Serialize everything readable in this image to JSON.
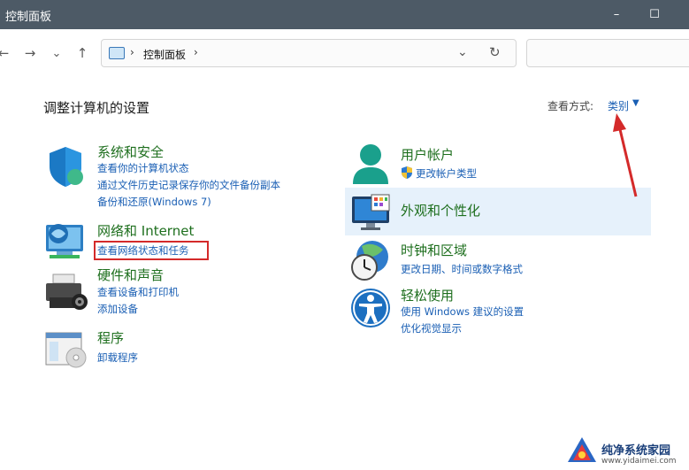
{
  "window": {
    "title": "控制面板",
    "minimize": "–",
    "maximize": "☐"
  },
  "nav": {
    "back": "←",
    "forward": "→",
    "recent": "⌄",
    "up": "↑"
  },
  "address": {
    "crumb": "控制面板",
    "sep1": "›",
    "sep2": "›",
    "dropdown": "⌄",
    "refresh": "↻",
    "icon": "control-panel-icon"
  },
  "search": {
    "placeholder": ""
  },
  "main": {
    "title": "调整计算机的设置",
    "view_label": "查看方式:",
    "view_value": "类别",
    "view_caret": "▼"
  },
  "left": [
    {
      "title": "系统和安全",
      "icon": "shield-icon",
      "links": [
        "查看你的计算机状态",
        "通过文件历史记录保存你的文件备份副本",
        "备份和还原(Windows 7)"
      ]
    },
    {
      "title": "网络和 Internet",
      "icon": "network-icon",
      "links": [
        "查看网络状态和任务"
      ]
    },
    {
      "title": "硬件和声音",
      "icon": "printer-icon",
      "links": [
        "查看设备和打印机",
        "添加设备"
      ]
    },
    {
      "title": "程序",
      "icon": "programs-icon",
      "links": [
        "卸载程序"
      ]
    }
  ],
  "right": [
    {
      "title": "用户帐户",
      "icon": "user-icon",
      "links": [
        "更改帐户类型"
      ]
    },
    {
      "title": "外观和个性化",
      "icon": "monitor-icon",
      "links": []
    },
    {
      "title": "时钟和区域",
      "icon": "clock-icon",
      "links": [
        "更改日期、时间或数字格式"
      ]
    },
    {
      "title": "轻松使用",
      "icon": "accessibility-icon",
      "links": [
        "使用 Windows 建议的设置",
        "优化视觉显示"
      ]
    }
  ],
  "annotations": {
    "highlight_color": "#d42a2a"
  },
  "watermark": {
    "name": "纯净系统家园",
    "url": "www.yidaimei.com"
  },
  "colors": {
    "titlebar": "#4d5a66",
    "category_title": "#1e6f1e",
    "link": "#1a5fb4",
    "hover_panel": "#e6f1fb"
  }
}
